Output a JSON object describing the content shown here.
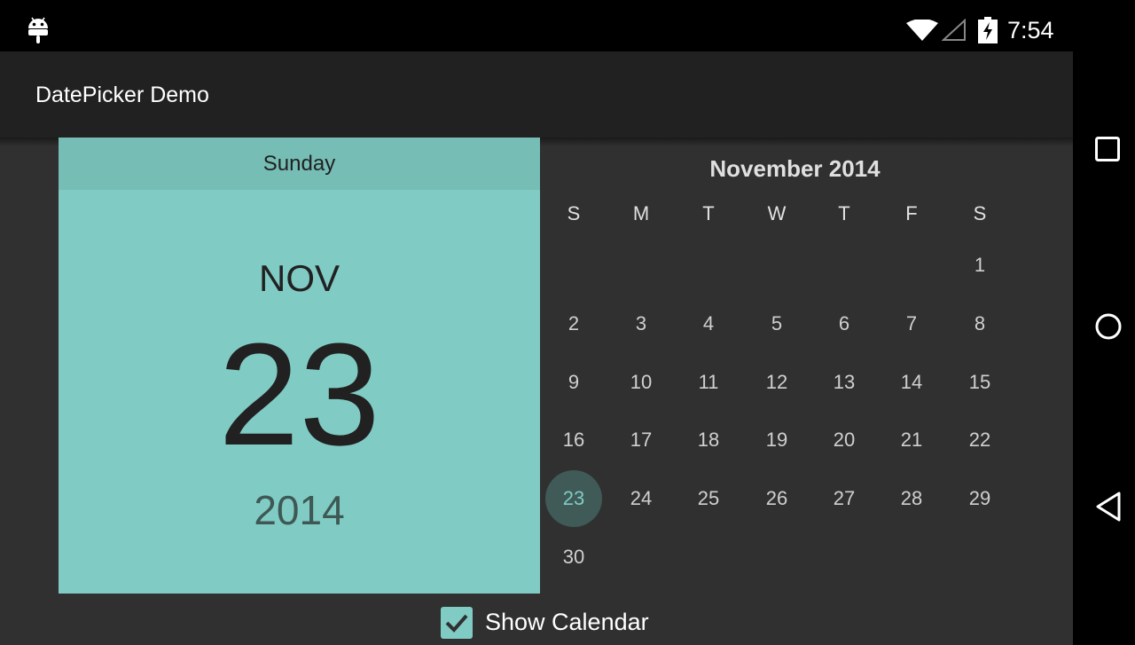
{
  "status_bar": {
    "time": "7:54",
    "icons": [
      "android-icon",
      "wifi-icon",
      "signal-icon",
      "battery-charging-icon"
    ]
  },
  "app_bar": {
    "title": "DatePicker Demo"
  },
  "date_picker": {
    "header": {
      "day_of_week": "Sunday",
      "month": "NOV",
      "day": "23",
      "year": "2014"
    },
    "calendar": {
      "month_title": "November 2014",
      "weekdays": [
        "S",
        "M",
        "T",
        "W",
        "T",
        "F",
        "S"
      ],
      "selected_date": "23",
      "weeks": [
        [
          "",
          "",
          "",
          "",
          "",
          "",
          "1"
        ],
        [
          "2",
          "3",
          "4",
          "5",
          "6",
          "7",
          "8"
        ],
        [
          "9",
          "10",
          "11",
          "12",
          "13",
          "14",
          "15"
        ],
        [
          "16",
          "17",
          "18",
          "19",
          "20",
          "21",
          "22"
        ],
        [
          "23",
          "24",
          "25",
          "26",
          "27",
          "28",
          "29"
        ],
        [
          "30",
          "",
          "",
          "",
          "",
          "",
          ""
        ]
      ]
    }
  },
  "show_calendar": {
    "label": "Show Calendar",
    "checked": true
  },
  "nav_bar": {
    "buttons": [
      "recents-icon",
      "home-icon",
      "back-icon"
    ]
  },
  "colors": {
    "accent": "#80cbc4",
    "header_dark": "#75bdb5",
    "background": "#303030",
    "app_bar": "#212121"
  }
}
